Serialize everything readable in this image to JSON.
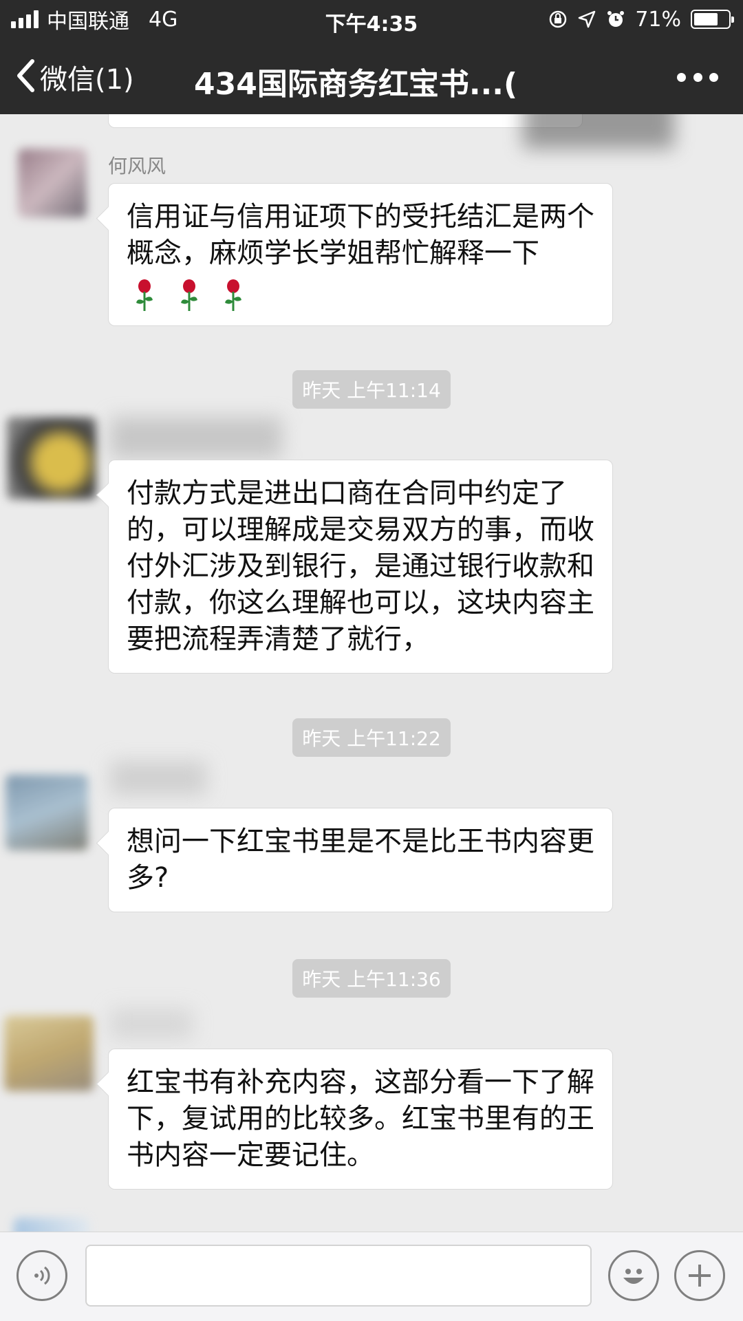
{
  "status_bar": {
    "carrier": "中国联通",
    "network": "4G",
    "time": "下午4:35",
    "battery_text": "71%",
    "battery_level": 0.71,
    "icons": [
      "signal-icon",
      "lock-rotation-icon",
      "location-arrow-icon",
      "alarm-icon",
      "battery-icon"
    ]
  },
  "nav": {
    "back_label": "微信(1)",
    "title": "434国际商务红宝书...(",
    "icons": [
      "back-chevron-icon",
      "more-dots-icon"
    ]
  },
  "chat": {
    "messages": [
      {
        "sender": "何风风",
        "text": "信用证与信用证项下的受托结汇是两个概念，麻烦学长学姐帮忙解释一下",
        "emoji": [
          "rose",
          "rose",
          "rose"
        ]
      },
      {
        "timestamp": "昨天 上午11:14"
      },
      {
        "text": "付款方式是进出口商在合同中约定了的，可以理解成是交易双方的事，而收付外汇涉及到银行，是通过银行收款和付款，你这么理解也可以，这块内容主要把流程弄清楚了就行，"
      },
      {
        "timestamp": "昨天 上午11:22"
      },
      {
        "text": "想问一下红宝书里是不是比王书内容更多?"
      },
      {
        "timestamp": "昨天 上午11:36"
      },
      {
        "text": "红宝书有补充内容，这部分看一下了解下，复试用的比较多。红宝书里有的王书内容一定要记住。"
      }
    ]
  },
  "input_bar": {
    "placeholder": "",
    "icons": [
      "voice-icon",
      "emoji-face-icon",
      "plus-icon"
    ]
  },
  "colors": {
    "header_bg": "#2b2b2b",
    "chat_bg": "#ebebeb",
    "bubble_bg": "#ffffff",
    "timestamp_bg": "#cecece"
  }
}
